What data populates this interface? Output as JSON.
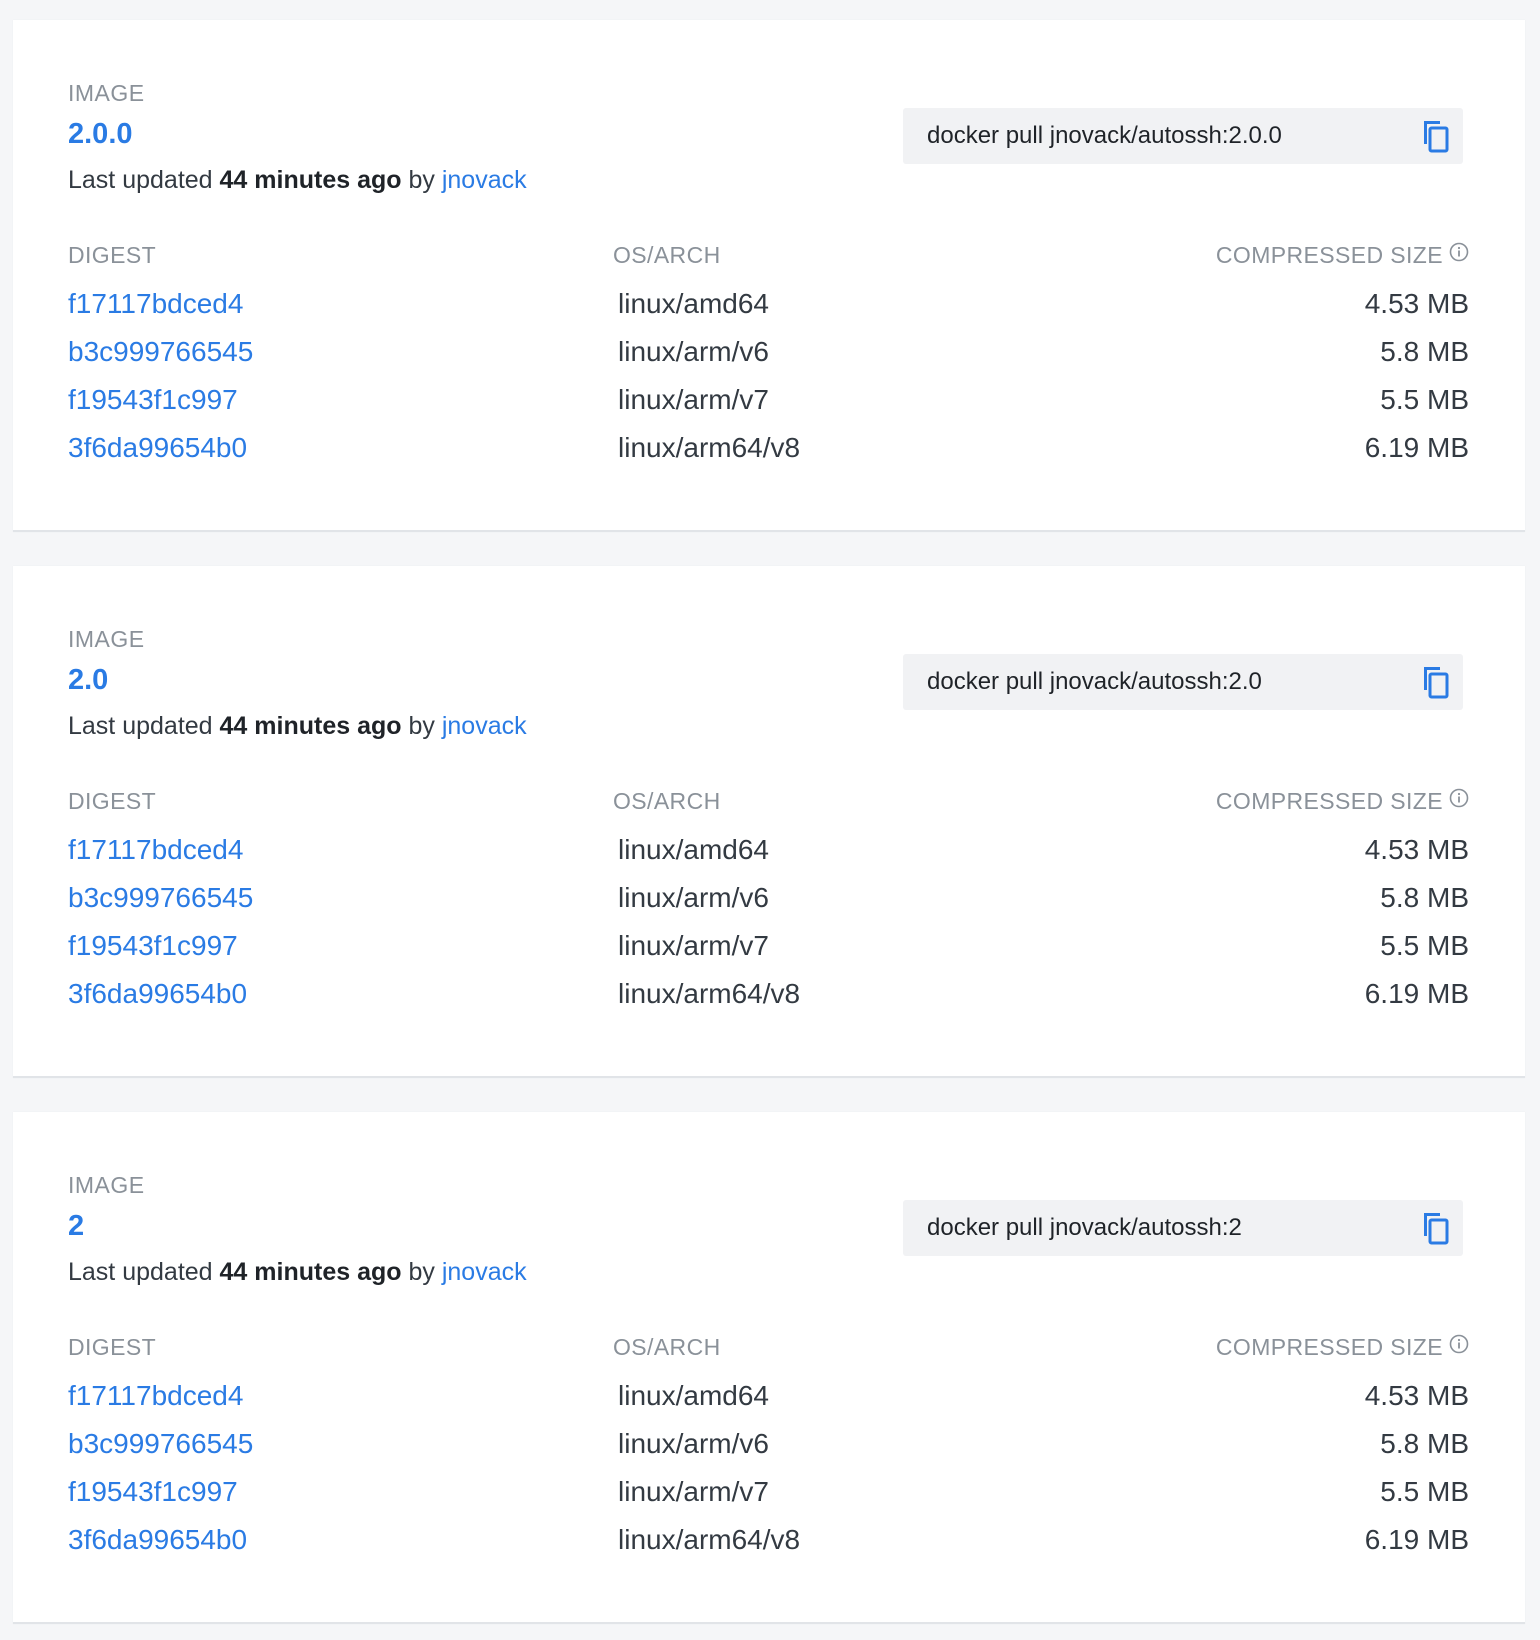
{
  "labels": {
    "image": "IMAGE",
    "last_updated_prefix": "Last updated",
    "by": "by",
    "digest": "DIGEST",
    "os_arch": "OS/ARCH",
    "compressed_size": "COMPRESSED SIZE"
  },
  "cards": [
    {
      "tag": "2.0.0",
      "updated_ago": "44 minutes ago",
      "user": "jnovack",
      "pull_command": "docker pull jnovack/autossh:2.0.0",
      "rows": [
        {
          "digest": "f17117bdced4",
          "os_arch": "linux/amd64",
          "size": "4.53 MB"
        },
        {
          "digest": "b3c999766545",
          "os_arch": "linux/arm/v6",
          "size": "5.8 MB"
        },
        {
          "digest": "f19543f1c997",
          "os_arch": "linux/arm/v7",
          "size": "5.5 MB"
        },
        {
          "digest": "3f6da99654b0",
          "os_arch": "linux/arm64/v8",
          "size": "6.19 MB"
        }
      ]
    },
    {
      "tag": "2.0",
      "updated_ago": "44 minutes ago",
      "user": "jnovack",
      "pull_command": "docker pull jnovack/autossh:2.0",
      "rows": [
        {
          "digest": "f17117bdced4",
          "os_arch": "linux/amd64",
          "size": "4.53 MB"
        },
        {
          "digest": "b3c999766545",
          "os_arch": "linux/arm/v6",
          "size": "5.8 MB"
        },
        {
          "digest": "f19543f1c997",
          "os_arch": "linux/arm/v7",
          "size": "5.5 MB"
        },
        {
          "digest": "3f6da99654b0",
          "os_arch": "linux/arm64/v8",
          "size": "6.19 MB"
        }
      ]
    },
    {
      "tag": "2",
      "updated_ago": "44 minutes ago",
      "user": "jnovack",
      "pull_command": "docker pull jnovack/autossh:2",
      "rows": [
        {
          "digest": "f17117bdced4",
          "os_arch": "linux/amd64",
          "size": "4.53 MB"
        },
        {
          "digest": "b3c999766545",
          "os_arch": "linux/arm/v6",
          "size": "5.8 MB"
        },
        {
          "digest": "f19543f1c997",
          "os_arch": "linux/arm/v7",
          "size": "5.5 MB"
        },
        {
          "digest": "3f6da99654b0",
          "os_arch": "linux/arm64/v8",
          "size": "6.19 MB"
        }
      ]
    }
  ],
  "icons": {
    "copy": "copy-icon",
    "info": "info-icon"
  },
  "colors": {
    "link": "#2a7be4",
    "muted": "#8a9199",
    "background": "#f5f6f8",
    "pull_box": "#f1f2f4"
  }
}
